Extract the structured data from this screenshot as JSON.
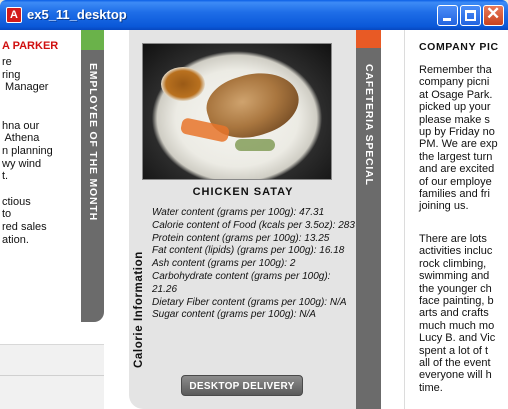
{
  "window": {
    "title": "ex5_11_desktop",
    "icon": "acrobat-icon"
  },
  "left": {
    "name": "A PARKER",
    "text": "re\nring\n Manager\n\n\nhna our\n Athena\nn planning\nwy wind\nt.\n\nctious\nto\nred sales\nation.",
    "tab_label": "EMPLOYEE OF THE MONTH",
    "tab_accent": "#6ab24a"
  },
  "middle": {
    "dish_title": "CHICKEN SATAY",
    "calorie_label": "Calorie Information",
    "nutrition": [
      "Water content (grams per 100g): 47.31",
      "Calorie content of Food (kcals per 3.5oz): 283",
      "Protein content (grams per 100g): 13.25",
      "Fat content (lipids) (grams per 100g): 16.18",
      "Ash content (grams per 100g): 2",
      "Carbohydrate content (grams per 100g): 21.26",
      "Dietary Fiber content (grams per 100g): N/A",
      "Sugar content (grams per 100g): N/A"
    ],
    "delivery_button": "DESKTOP DELIVERY",
    "tab_label": "CAFETERIA SPECIAL",
    "tab_accent": "#e85a25"
  },
  "right": {
    "title": "COMPANY PIC",
    "text": "Remember tha\ncompany picni\nat Osage Park.\npicked up your\nplease make s\nup by Friday no\nPM. We are exp\nthe largest turn\nand are excited\nof our employe\nfamilies and fri\njoining us.",
    "text2": "There are lots\nactivities incluc\nrock climbing,\nswimming and\nthe younger ch\nface painting, b\narts and crafts\nmuch much mo\nLucy B. and Vic\nspent a lot of t\nall of the event\neveryone will h\ntime."
  }
}
